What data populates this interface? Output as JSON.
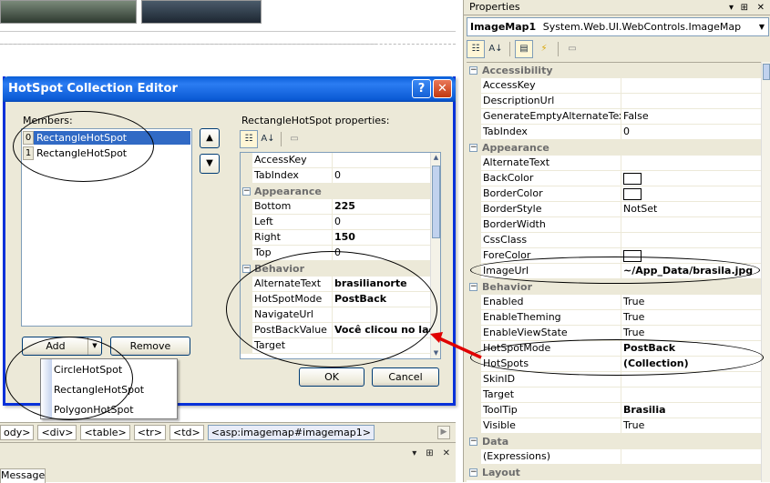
{
  "properties_panel": {
    "title": "Properties",
    "controls": [
      "▾",
      "⊞",
      "✕"
    ],
    "object_name": "ImageMap1",
    "object_type": "System.Web.UI.WebControls.ImageMap",
    "toolbar_icons": [
      "categorized-icon",
      "alphabetical-icon",
      "properties-icon",
      "events-icon",
      "property-pages-icon"
    ],
    "rows": [
      {
        "kind": "cat",
        "name": "Accessibility",
        "mark": "−"
      },
      {
        "kind": "prop",
        "name": "AccessKey",
        "value": ""
      },
      {
        "kind": "prop",
        "name": "DescriptionUrl",
        "value": ""
      },
      {
        "kind": "prop",
        "name": "GenerateEmptyAlternateText",
        "value": "False"
      },
      {
        "kind": "prop",
        "name": "TabIndex",
        "value": "0"
      },
      {
        "kind": "cat",
        "name": "Appearance",
        "mark": "−"
      },
      {
        "kind": "prop",
        "name": "AlternateText",
        "value": ""
      },
      {
        "kind": "prop",
        "name": "BackColor",
        "value": "",
        "swatch": true
      },
      {
        "kind": "prop",
        "name": "BorderColor",
        "value": "",
        "swatch": true
      },
      {
        "kind": "prop",
        "name": "BorderStyle",
        "value": "NotSet"
      },
      {
        "kind": "prop",
        "name": "BorderWidth",
        "value": ""
      },
      {
        "kind": "prop",
        "name": "CssClass",
        "value": ""
      },
      {
        "kind": "prop",
        "name": "ForeColor",
        "value": "",
        "swatch": true
      },
      {
        "kind": "prop",
        "name": "ImageUrl",
        "value": "~/App_Data/brasila.jpg",
        "bold": true
      },
      {
        "kind": "cat",
        "name": "Behavior",
        "mark": "−"
      },
      {
        "kind": "prop",
        "name": "Enabled",
        "value": "True"
      },
      {
        "kind": "prop",
        "name": "EnableTheming",
        "value": "True"
      },
      {
        "kind": "prop",
        "name": "EnableViewState",
        "value": "True"
      },
      {
        "kind": "prop",
        "name": "HotSpotMode",
        "value": "PostBack",
        "bold": true
      },
      {
        "kind": "prop",
        "name": "HotSpots",
        "value": "(Collection)",
        "bold": true
      },
      {
        "kind": "prop",
        "name": "SkinID",
        "value": ""
      },
      {
        "kind": "prop",
        "name": "Target",
        "value": ""
      },
      {
        "kind": "prop",
        "name": "ToolTip",
        "value": "Brasilia",
        "bold": true
      },
      {
        "kind": "prop",
        "name": "Visible",
        "value": "True"
      },
      {
        "kind": "cat",
        "name": "Data",
        "mark": "−"
      },
      {
        "kind": "prop",
        "name": "(Expressions)",
        "value": ""
      },
      {
        "kind": "cat",
        "name": "Layout",
        "mark": "−"
      }
    ]
  },
  "dialog": {
    "title": "HotSpot Collection Editor",
    "help_glyph": "?",
    "close_glyph": "✕",
    "members_label": "Members:",
    "members": [
      {
        "index": "0",
        "name": "RectangleHotSpot",
        "selected": true
      },
      {
        "index": "1",
        "name": "RectangleHotSpot",
        "selected": false
      }
    ],
    "move_up_glyph": "▲",
    "move_down_glyph": "▼",
    "add_label": "Add",
    "add_dropdown_glyph": "▼",
    "remove_label": "Remove",
    "ok_label": "OK",
    "cancel_label": "Cancel",
    "props_label": "RectangleHotSpot properties:",
    "add_menu": [
      "CircleHotSpot",
      "RectangleHotSpot",
      "PolygonHotSpot"
    ],
    "inner_rows": [
      {
        "kind": "prop",
        "name": "AccessKey",
        "value": ""
      },
      {
        "kind": "prop",
        "name": "TabIndex",
        "value": "0"
      },
      {
        "kind": "cat",
        "name": "Appearance",
        "mark": "−"
      },
      {
        "kind": "prop",
        "name": "Bottom",
        "value": "225",
        "bold": true
      },
      {
        "kind": "prop",
        "name": "Left",
        "value": "0"
      },
      {
        "kind": "prop",
        "name": "Right",
        "value": "150",
        "bold": true
      },
      {
        "kind": "prop",
        "name": "Top",
        "value": "0"
      },
      {
        "kind": "cat",
        "name": "Behavior",
        "mark": "−"
      },
      {
        "kind": "prop",
        "name": "AlternateText",
        "value": "brasilianorte",
        "bold": true
      },
      {
        "kind": "prop",
        "name": "HotSpotMode",
        "value": "PostBack",
        "bold": true
      },
      {
        "kind": "prop",
        "name": "NavigateUrl",
        "value": ""
      },
      {
        "kind": "prop",
        "name": "PostBackValue",
        "value": "Você clicou no lad",
        "bold": true
      },
      {
        "kind": "prop",
        "name": "Target",
        "value": ""
      }
    ]
  },
  "tagbar": {
    "tags": [
      "ody>",
      "<div>",
      "<table>",
      "<tr>",
      "<td>",
      "<asp:imagemap#imagemap1>"
    ],
    "selected_index": 5
  },
  "bottom_panel": {
    "controls": [
      "▾",
      "⊞",
      "✕"
    ],
    "tab_label": "Messages"
  },
  "colors": {
    "title_blue": "#0a5fd8",
    "selection": "#316ac5",
    "annotation_arrow": "#e00000"
  }
}
